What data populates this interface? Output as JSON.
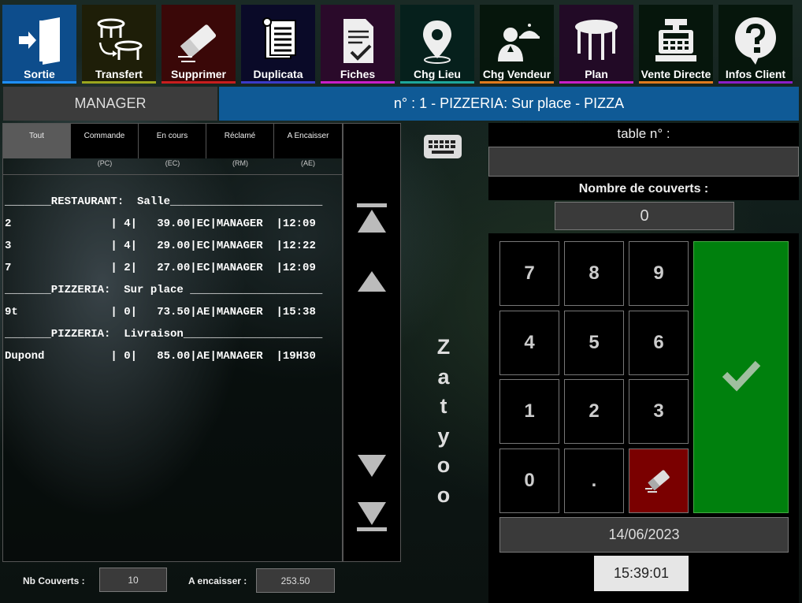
{
  "toolbar": [
    {
      "label": "Sortie",
      "icon": "exit-door-icon",
      "bg": "#0d4d8c",
      "bar": "#1e90ff"
    },
    {
      "label": "Transfert",
      "icon": "table-transfer-icon",
      "bg": "#1e1e08",
      "bar": "#9aa61e"
    },
    {
      "label": "Supprimer",
      "icon": "eraser-icon",
      "bg": "#3a0808",
      "bar": "#c81e1e"
    },
    {
      "label": "Duplicata",
      "icon": "duplicate-receipt-icon",
      "bg": "#0a0a28",
      "bar": "#3b3bc8"
    },
    {
      "label": "Fiches",
      "icon": "checklist-icon",
      "bg": "#2a0a2a",
      "bar": "#c81ec8"
    },
    {
      "label": "Chg Lieu",
      "icon": "location-pin-icon",
      "bg": "#06201c",
      "bar": "#1ea69a"
    },
    {
      "label": "Chg Vendeur",
      "icon": "waiter-icon",
      "bg": "#06160c",
      "bar": "#e07a1e"
    },
    {
      "label": "Plan",
      "icon": "round-table-icon",
      "bg": "#220a26",
      "bar": "#c81ec8"
    },
    {
      "label": "Vente Directe",
      "icon": "cash-register-icon",
      "bg": "#06160c",
      "bar": "#e07a1e"
    },
    {
      "label": "Infos Client",
      "icon": "question-bubble-icon",
      "bg": "#06160c",
      "bar": "#8a1ec8"
    }
  ],
  "header": {
    "role": "MANAGER",
    "title": "n° : 1 - PIZZERIA: Sur place  - PIZZA"
  },
  "tabs": [
    {
      "label": "Tout",
      "sub": ""
    },
    {
      "label": "Commande",
      "sub": "(PC)"
    },
    {
      "label": "En cours",
      "sub": "(EC)"
    },
    {
      "label": "Réclamé",
      "sub": "(RM)"
    },
    {
      "label": "A Encaisser",
      "sub": "(AE)"
    }
  ],
  "rows": [
    "_______RESTAURANT:  Salle_______________________",
    "2               | 4|   39.00|EC|MANAGER  |12:09",
    "3               | 4|   29.00|EC|MANAGER  |12:22",
    "7               | 2|   27.00|EC|MANAGER  |12:09",
    "_______PIZZERIA:  Sur place ____________________",
    "9t              | 0|   73.50|AE|MANAGER  |15:38",
    "_______PIZZERIA:  Livraison_____________________",
    "Dupond          | 0|   85.00|AE|MANAGER  |19H30"
  ],
  "footer": {
    "covers_label": "Nb Couverts :",
    "covers_value": "10",
    "cash_label": "A encaisser :",
    "cash_value": "253.50"
  },
  "brand": "Zatyoo",
  "right": {
    "table_label": "table  n° :",
    "table_value": "",
    "covers_label": "Nombre de couverts :",
    "covers_value": "0",
    "keys": [
      "7",
      "8",
      "9",
      "4",
      "5",
      "6",
      "1",
      "2",
      "3",
      "0",
      "."
    ],
    "date": "14/06/2023",
    "time": "15:39:01"
  },
  "colors": {
    "accent": "#0f5a96",
    "validate": "#00800d",
    "clear": "#7a0000"
  }
}
